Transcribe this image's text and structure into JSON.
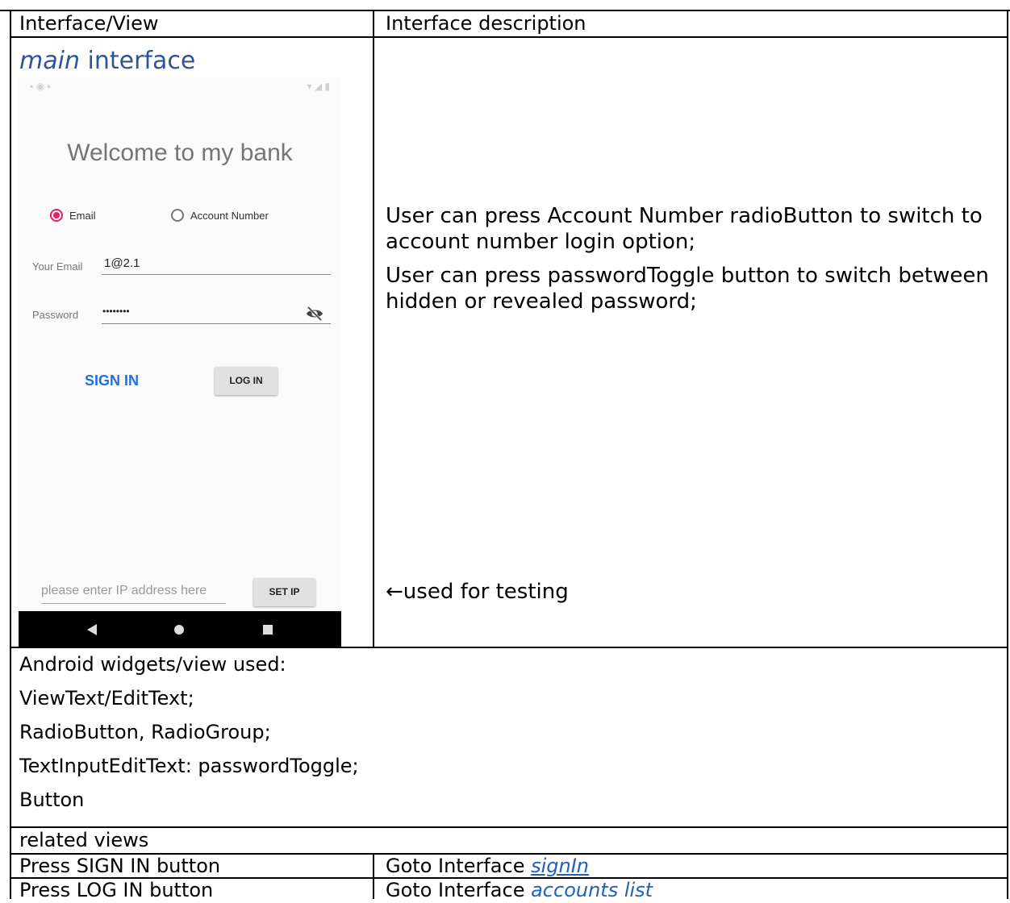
{
  "header": {
    "col1": "Interface/View",
    "col2": "Interface description"
  },
  "main_title": {
    "italic": "main",
    "rest": " interface"
  },
  "phone": {
    "welcome": "Welcome to my bank",
    "radio_email": "Email",
    "radio_account": "Account Number",
    "email_label": "Your Email",
    "email_value": "1@2.1",
    "password_label": "Password",
    "password_value": "••••••••",
    "sign_in": "SIGN IN",
    "log_in": "LOG IN",
    "ip_placeholder": "please enter IP address here",
    "set_ip": "SET IP",
    "accent_color": "#e91e63",
    "link_color": "#1e6fe0"
  },
  "description": {
    "line1": "User can press Account Number radioButton to switch to",
    "line2": "account number login option;",
    "line3": "User can press passwordToggle button to switch between",
    "line4": "hidden or revealed password;",
    "testing": "used for testing",
    "testing_arrow": "←"
  },
  "widgets": {
    "line1": "Android widgets/view used:",
    "line2": "ViewText/EditText;",
    "line3": "RadioButton, RadioGroup;",
    "line4": "TextInputEditText: passwordToggle;",
    "line5": "Button"
  },
  "related": {
    "title": "related views",
    "rows": [
      {
        "action": "Press SIGN IN button",
        "goto": "Goto Interface ",
        "target": "signIn"
      },
      {
        "action": "Press LOG IN button",
        "goto": "Goto Interface ",
        "target": "accounts list"
      }
    ]
  }
}
